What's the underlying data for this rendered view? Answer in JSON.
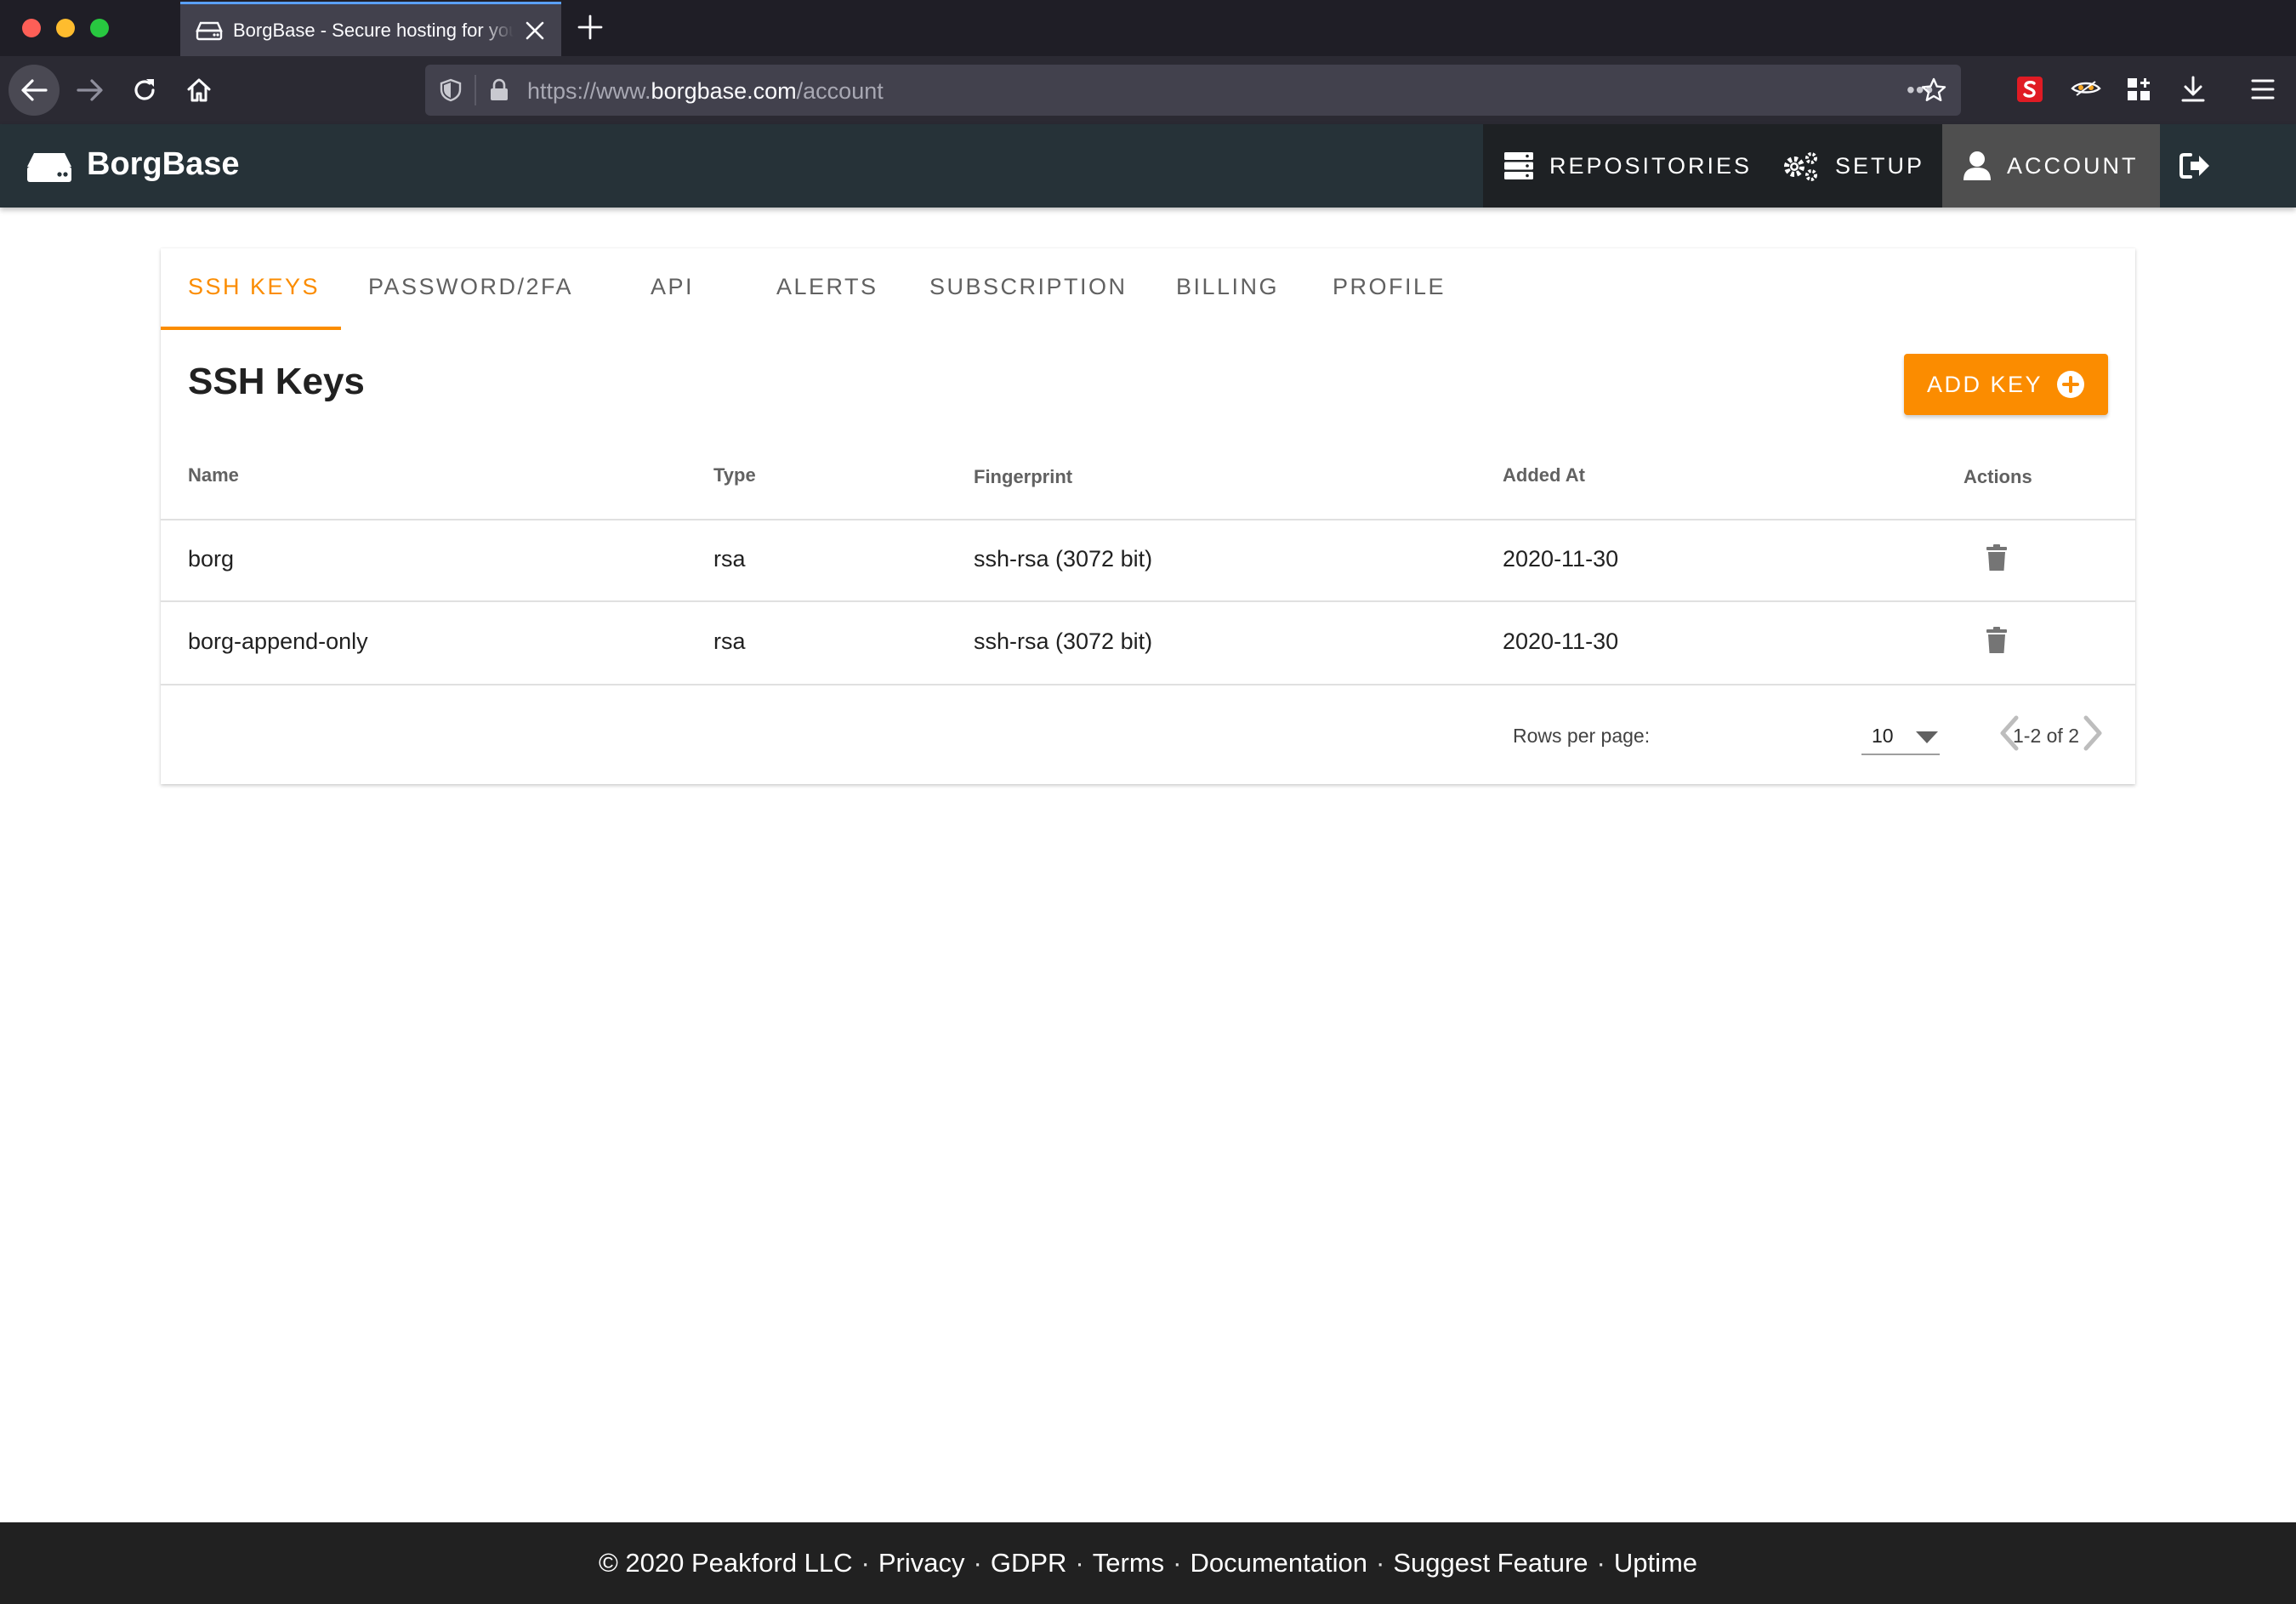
{
  "browser": {
    "tab_title": "BorgBase - Secure hosting for your backups",
    "url_prefix": "https://www.",
    "url_host": "borgbase.com",
    "url_path": "/account",
    "url_more": "•••"
  },
  "app": {
    "brand": "BorgBase",
    "nav": {
      "repositories": "REPOSITORIES",
      "setup": "SETUP",
      "account": "ACCOUNT"
    }
  },
  "account_tabs": [
    "SSH KEYS",
    "PASSWORD/2FA",
    "API",
    "ALERTS",
    "SUBSCRIPTION",
    "BILLING",
    "PROFILE"
  ],
  "ssh": {
    "title": "SSH Keys",
    "add_button": "ADD KEY",
    "columns": {
      "name": "Name",
      "type": "Type",
      "fingerprint": "Fingerprint",
      "added_at": "Added At",
      "actions": "Actions"
    },
    "rows": [
      {
        "name": "borg",
        "type": "rsa",
        "fingerprint": "ssh-rsa (3072 bit)",
        "added_at": "2020-11-30"
      },
      {
        "name": "borg-append-only",
        "type": "rsa",
        "fingerprint": "ssh-rsa (3072 bit)",
        "added_at": "2020-11-30"
      }
    ],
    "pagination": {
      "rows_per_page_label": "Rows per page:",
      "rows_per_page": "10",
      "range": "1-2 of 2"
    }
  },
  "footer": {
    "copyright": "© 2020 Peakford LLC",
    "links": [
      "Privacy",
      "GDPR",
      "Terms",
      "Documentation",
      "Suggest Feature",
      "Uptime"
    ],
    "separator": "·"
  },
  "colors": {
    "accent": "#fb8c00",
    "appbar": "#263238",
    "footer": "#212121"
  }
}
